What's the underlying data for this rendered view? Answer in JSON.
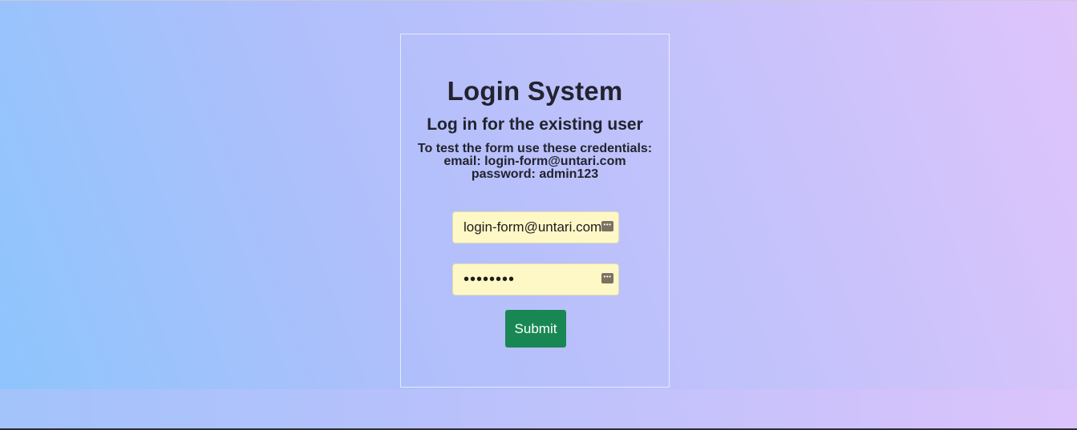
{
  "login": {
    "title": "Login System",
    "subtitle": "Log in for the existing user",
    "hint_line1": "To test the form use these credentials:",
    "hint_line2": "email: login-form@untari.com",
    "hint_line3": "password: admin123",
    "email_value": "login-form@untari.com",
    "password_value": "admin123",
    "submit_label": "Submit"
  },
  "icons": {
    "autofill": "password-manager-icon"
  },
  "colors": {
    "submit_bg": "#198754",
    "field_bg": "#fef7c6",
    "gradient_start": "#8ec5fc",
    "gradient_end": "#e0c3fc"
  }
}
